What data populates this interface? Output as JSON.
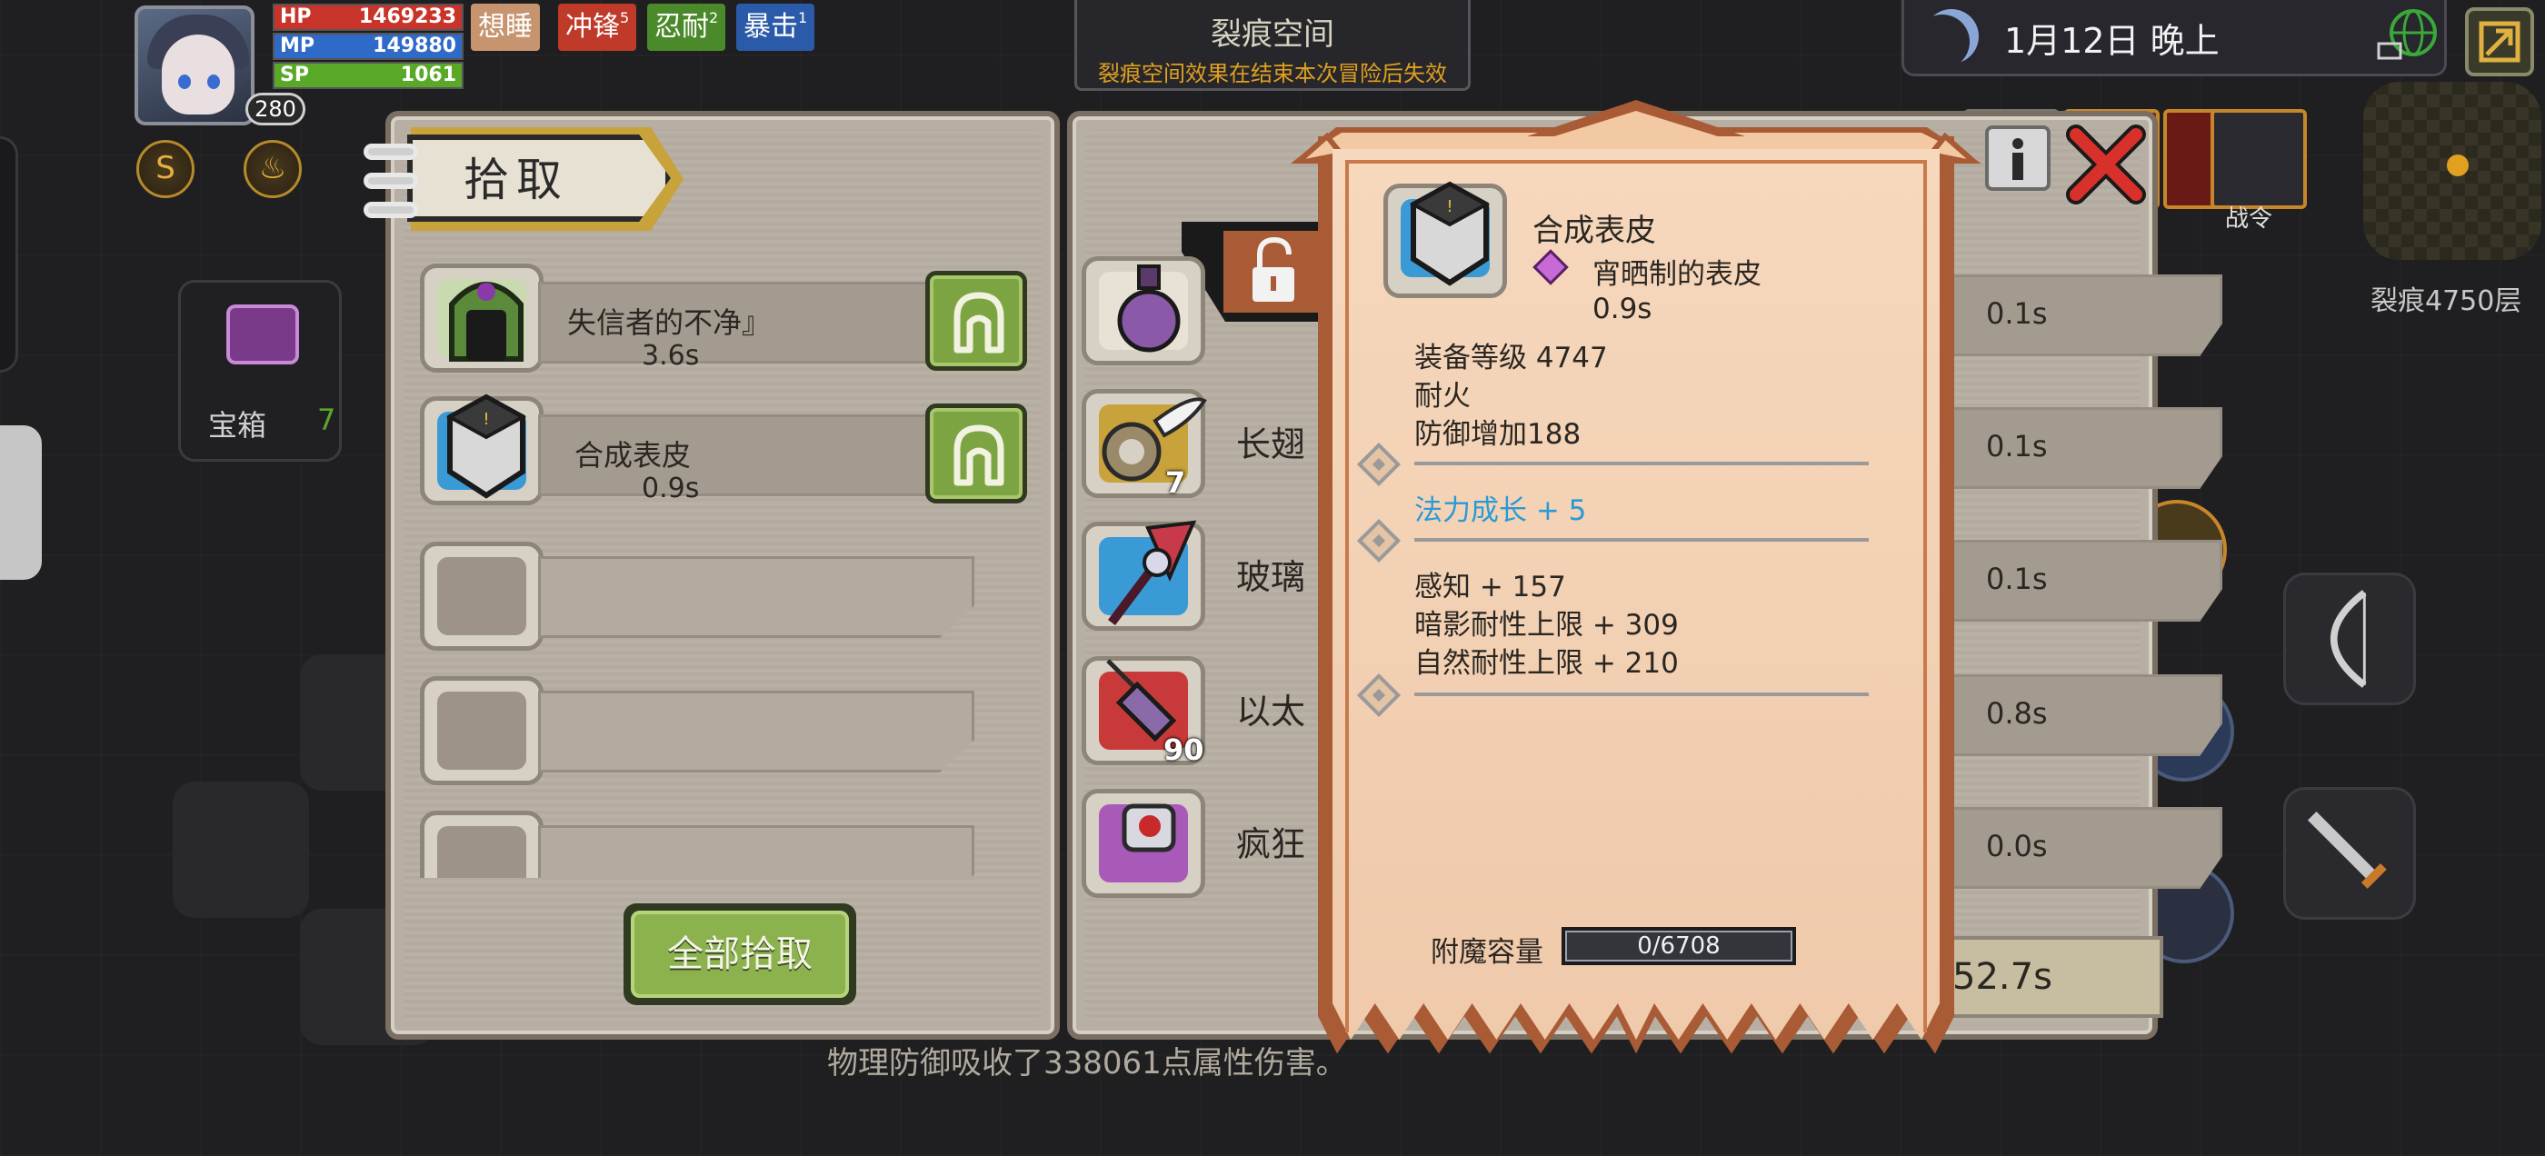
{
  "hud": {
    "hp_label": "HP",
    "hp_value": "1469233",
    "mp_label": "MP",
    "mp_value": "149880",
    "sp_label": "SP",
    "sp_value": "1061",
    "level": "280",
    "buffs": [
      {
        "label": "想睡",
        "sup": "",
        "color": "#c79470"
      },
      {
        "label": "冲锋",
        "sup": "5",
        "color": "#c03a2a"
      },
      {
        "label": "忍耐",
        "sup": "2",
        "color": "#4a8a2a"
      },
      {
        "label": "暴击",
        "sup": "1",
        "color": "#2a5aa8"
      }
    ],
    "chest_label": "宝箱",
    "chest_count": "7"
  },
  "zone": {
    "title": "裂痕空间",
    "subtitle": "裂痕空间效果在结束本次冒险后失效"
  },
  "clock": {
    "text": "1月12日 晚上"
  },
  "minimap": {
    "floor_label": "裂痕4750层"
  },
  "top_right_icons": {
    "war_order_label": "战令"
  },
  "pickup_panel": {
    "title": "拾取",
    "items": [
      {
        "name": "失信者的不净』",
        "time": "3.6s"
      },
      {
        "name": "合成表皮",
        "time": "0.9s"
      }
    ],
    "pick_all_label": "全部拾取"
  },
  "loot_panel": {
    "items": [
      {
        "name": "",
        "count": "",
        "time": "0.1s"
      },
      {
        "name": "长翅",
        "count": "7",
        "time": "0.1s"
      },
      {
        "name": "玻璃",
        "count": "",
        "time": "0.1s"
      },
      {
        "name": "以太",
        "count": "90",
        "time": "0.8s"
      },
      {
        "name": "疯狂",
        "count": "",
        "time": "0.0s"
      }
    ],
    "total_time": "52.7s"
  },
  "tooltip": {
    "name": "合成表皮",
    "type": "宵晒制的表皮",
    "time": "0.9s",
    "level": "装备等级 4747",
    "trait": "耐火",
    "defense": "防御增加188",
    "bonus": "法力成长 + 5",
    "bonus_color": "#2a9ad6",
    "stats": [
      "感知 + 157",
      "暗影耐性上限 + 309",
      "自然耐性上限 + 210"
    ],
    "enchant_label": "附魔容量",
    "enchant_value": "0/6708",
    "enchant_fill": 0
  },
  "log": {
    "message": "物理防御吸收了338061点属性伤害。"
  }
}
